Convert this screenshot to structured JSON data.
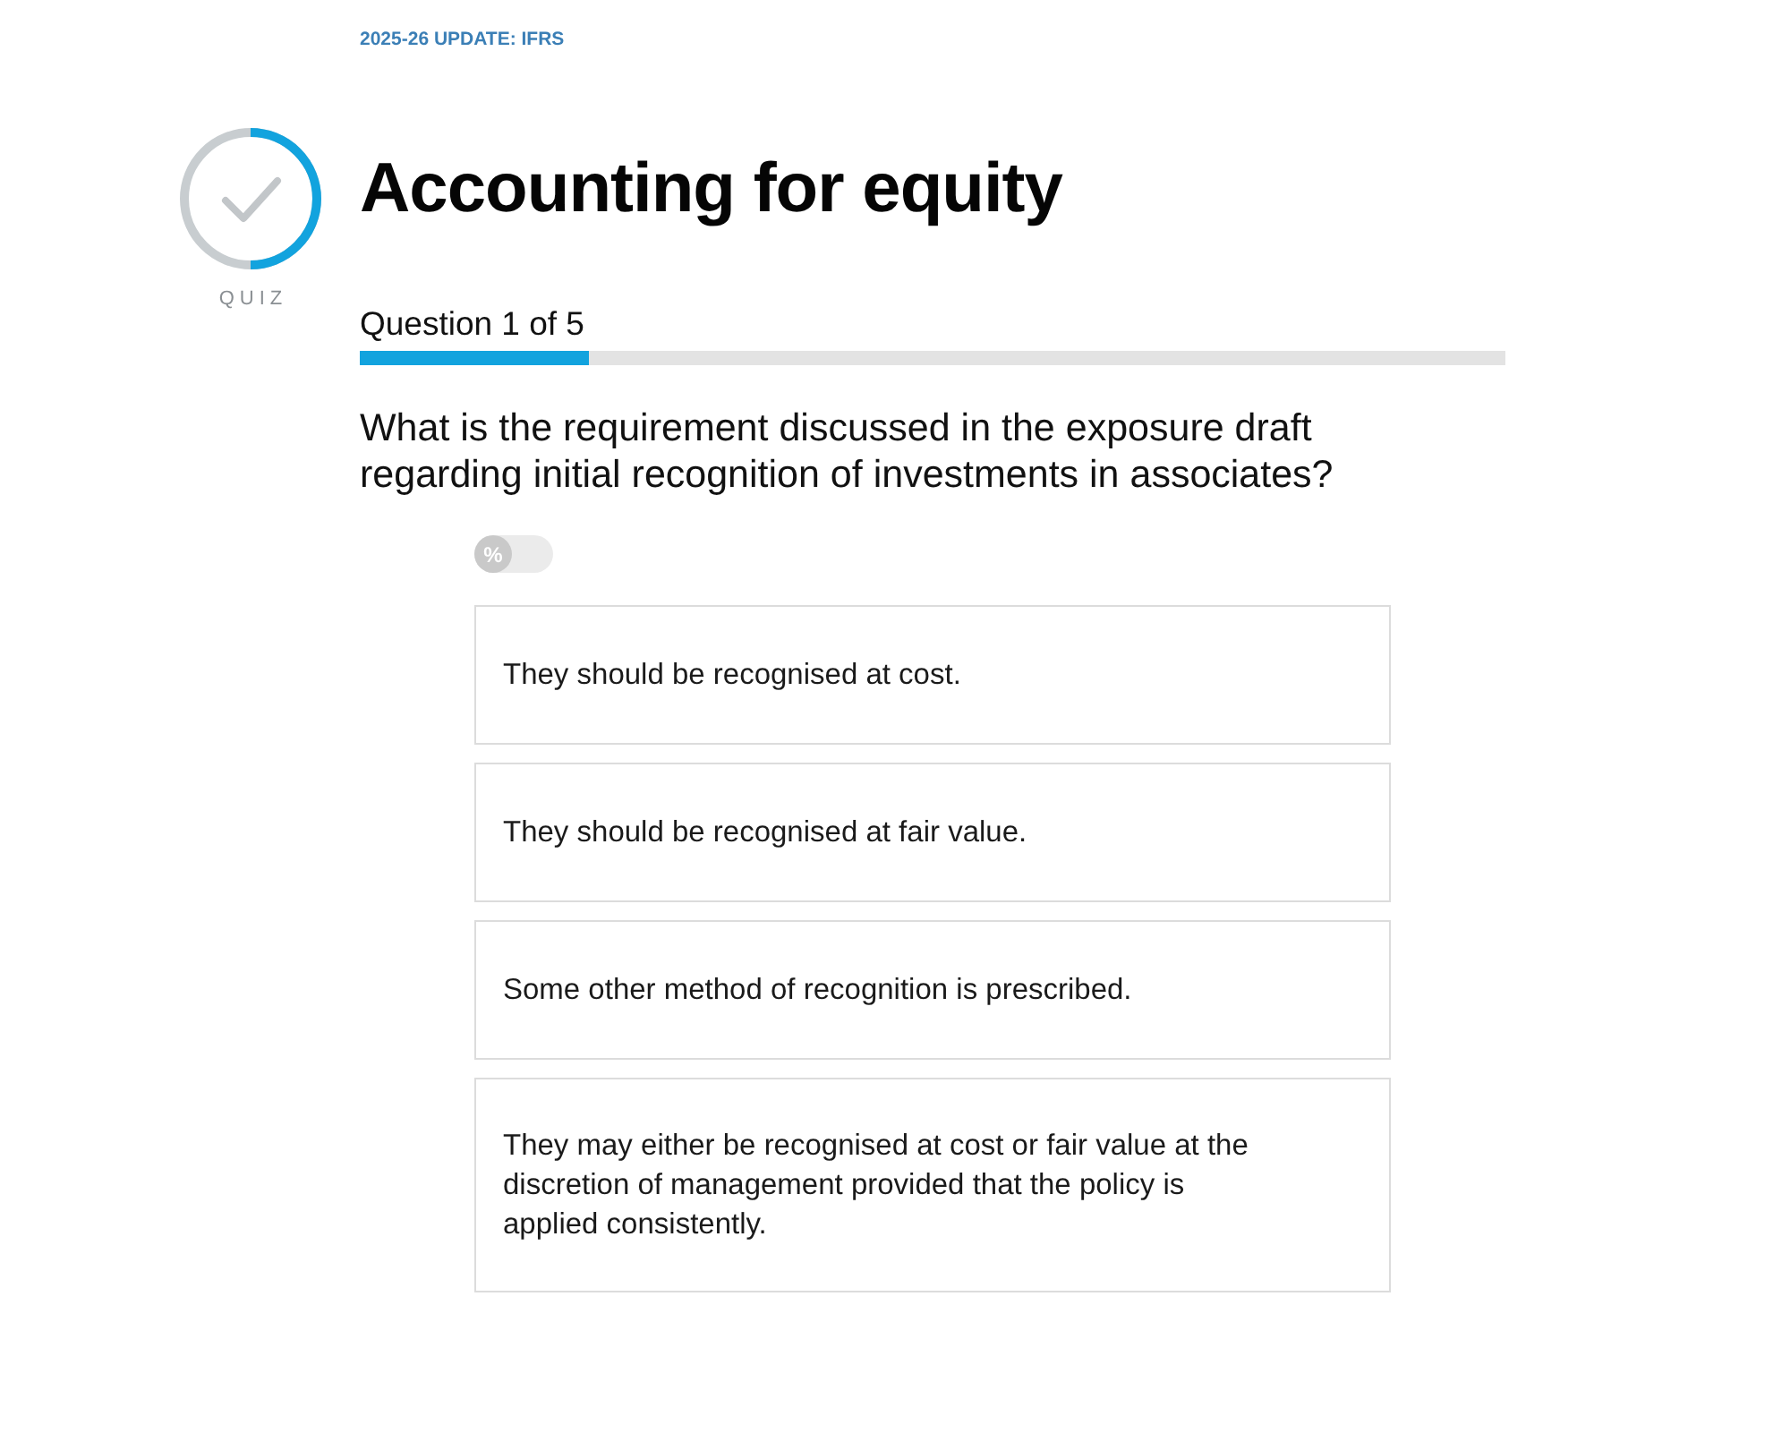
{
  "course_label": "2025-26 UPDATE: IFRS",
  "quiz_label": "QUIZ",
  "title": "Accounting for equity",
  "progress": {
    "label": "Question 1 of 5",
    "level": 0.2
  },
  "question": "What is the requirement discussed in the exposure draft regarding initial recognition of investments in associates?",
  "percent_toggle": {
    "label": "%",
    "on": false
  },
  "answers": [
    {
      "text": "They should be recognised at cost.",
      "selected": false
    },
    {
      "text": "They should be recognised at fair value.",
      "selected": false
    },
    {
      "text": "Some other method of recognition is prescribed.",
      "selected": false
    },
    {
      "text": "They may either be recognised at cost or fair value at the discretion of management provided that the policy is applied consistently.",
      "selected": false
    }
  ]
}
